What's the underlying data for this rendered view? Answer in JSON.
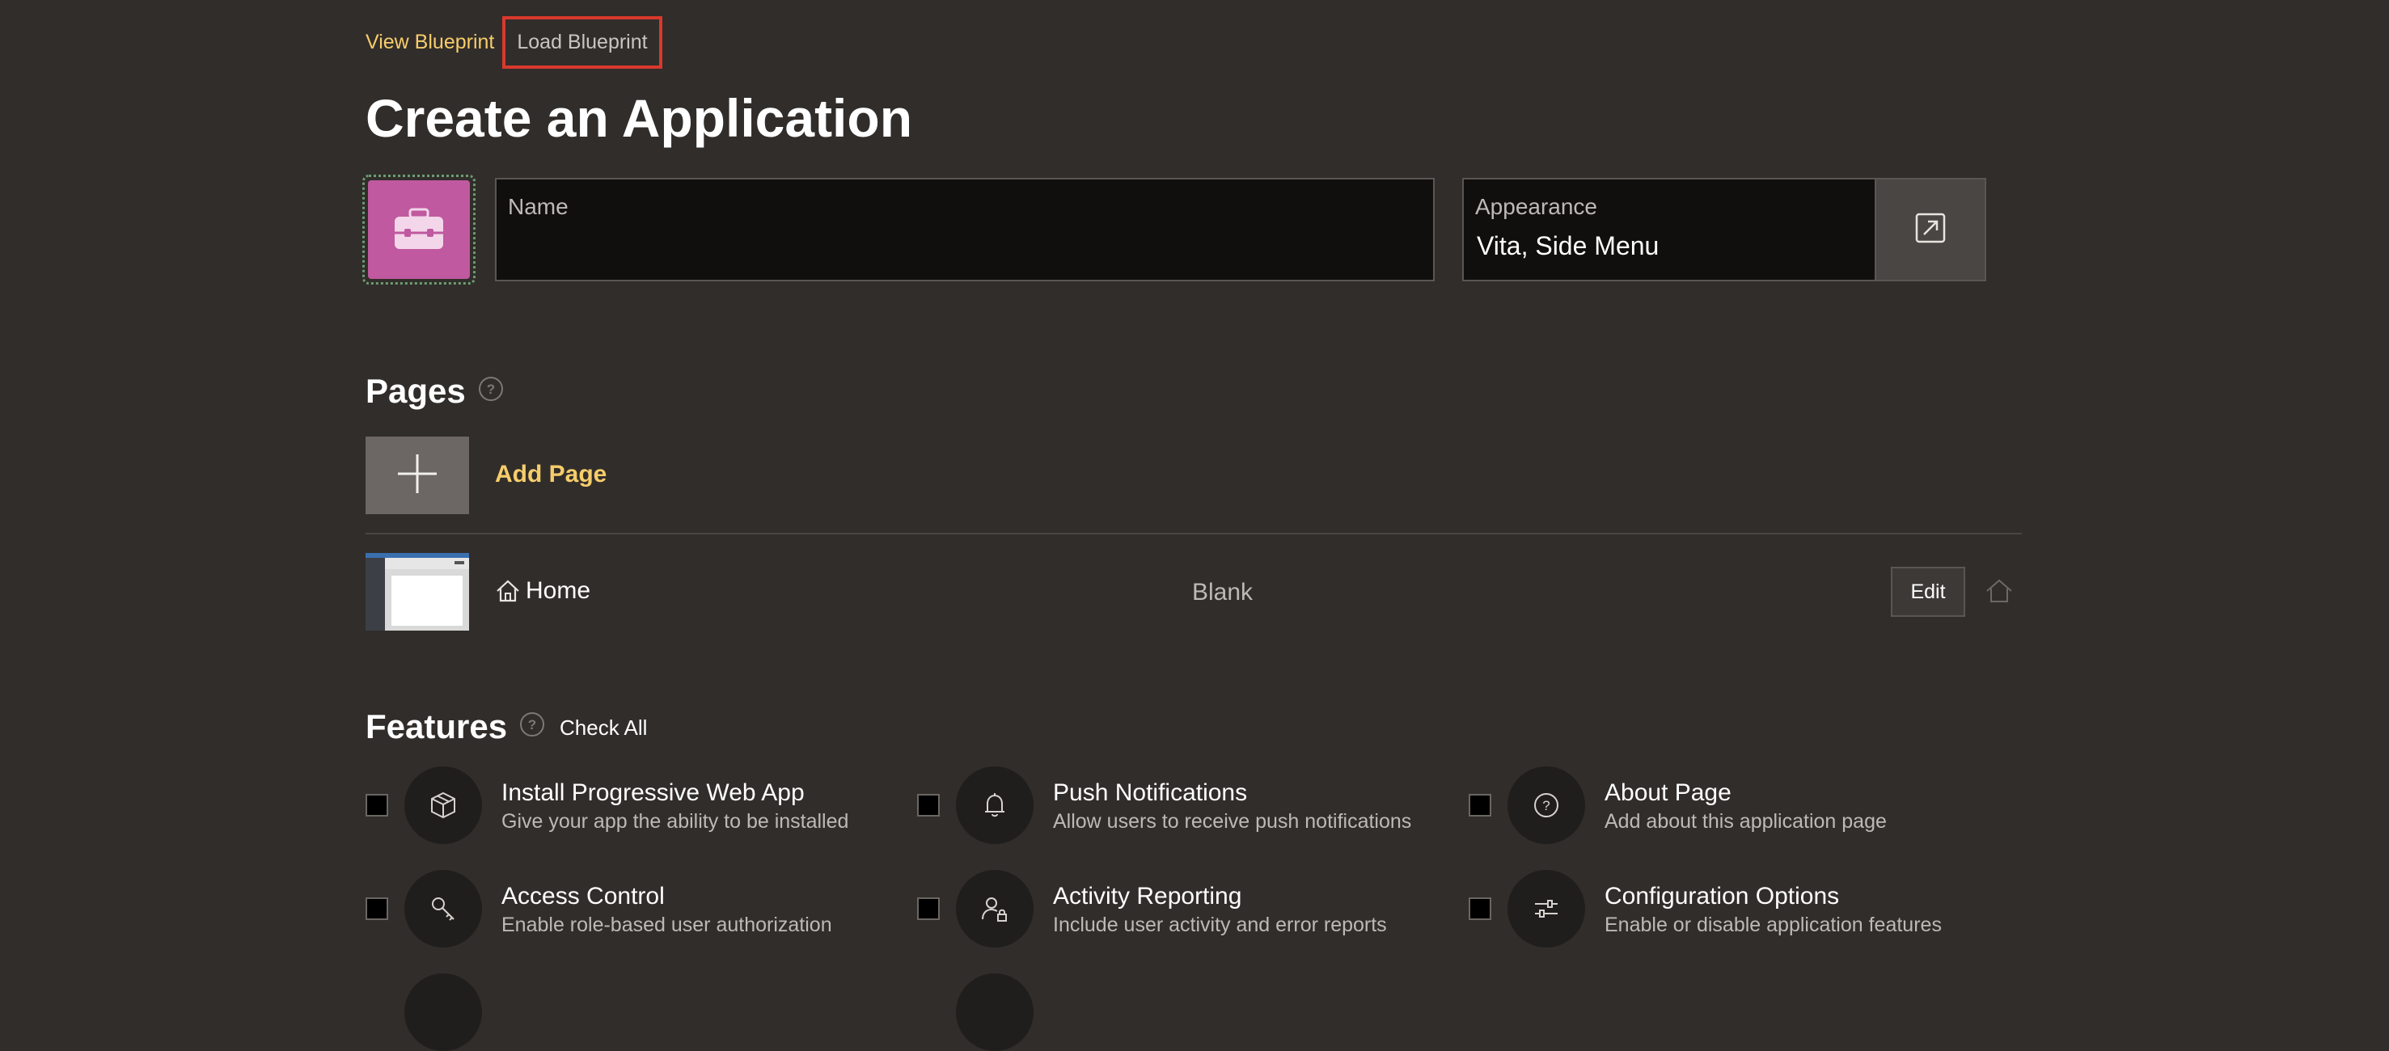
{
  "top_links": {
    "view_blueprint": "View Blueprint",
    "load_blueprint": "Load Blueprint"
  },
  "title": "Create an Application",
  "app_icon": {
    "icon": "briefcase-icon",
    "color": "#c0599f"
  },
  "name_field": {
    "label": "Name",
    "value": ""
  },
  "appearance": {
    "label": "Appearance",
    "value": "Vita, Side Menu",
    "button_icon": "external-link-icon"
  },
  "pages": {
    "title": "Pages",
    "add_page_label": "Add Page",
    "items": [
      {
        "name": "Home",
        "type": "Blank",
        "edit_label": "Edit"
      }
    ]
  },
  "features": {
    "title": "Features",
    "check_all": "Check All",
    "items": [
      {
        "title": "Install Progressive Web App",
        "description": "Give your app the ability to be installed",
        "icon": "package-icon",
        "checked": false
      },
      {
        "title": "Push Notifications",
        "description": "Allow users to receive push notifications",
        "icon": "bell-icon",
        "checked": false
      },
      {
        "title": "About Page",
        "description": "Add about this application page",
        "icon": "question-circle-icon",
        "checked": false
      },
      {
        "title": "Access Control",
        "description": "Enable role-based user authorization",
        "icon": "key-icon",
        "checked": false
      },
      {
        "title": "Activity Reporting",
        "description": "Include user activity and error reports",
        "icon": "user-lock-icon",
        "checked": false
      },
      {
        "title": "Configuration Options",
        "description": "Enable or disable application features",
        "icon": "sliders-icon",
        "checked": false
      }
    ]
  },
  "colors": {
    "background": "#312d2a",
    "accent": "#f6cd6b",
    "highlight_border": "#d8392c"
  }
}
